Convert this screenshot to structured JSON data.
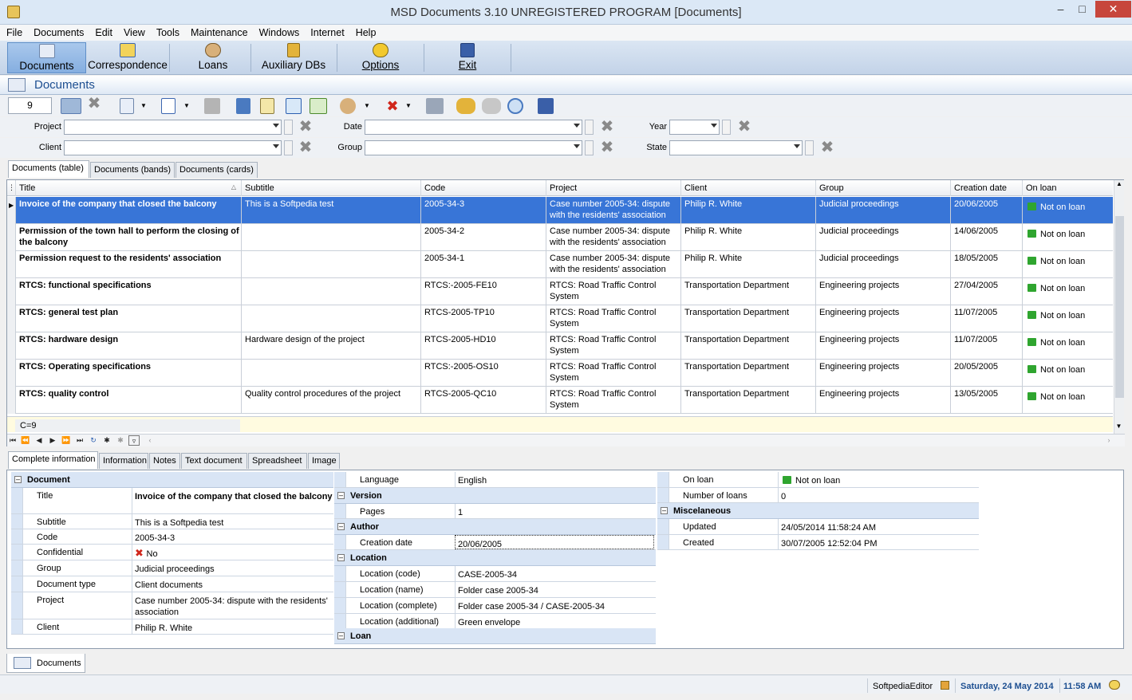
{
  "window": {
    "title": "MSD Documents 3.10 UNREGISTERED PROGRAM [Documents]"
  },
  "menu": [
    "File",
    "Documents",
    "Edit",
    "View",
    "Tools",
    "Maintenance",
    "Windows",
    "Internet",
    "Help"
  ],
  "maintoolbar": [
    {
      "label": "Documents",
      "icon": "documents-icon",
      "active": true
    },
    {
      "label": "Correspondence",
      "icon": "correspondence-arrows-icon"
    },
    {
      "label": "Loans",
      "icon": "loans-person-icon"
    },
    {
      "label": "Auxiliary DBs",
      "icon": "database-icon"
    },
    {
      "label": "Options",
      "icon": "options-gears-icon"
    },
    {
      "label": "Exit",
      "icon": "exit-door-icon"
    }
  ],
  "docheader": {
    "title": "Documents"
  },
  "smalltoolbar": {
    "count": "9"
  },
  "filters": {
    "project": "Project",
    "date": "Date",
    "year": "Year",
    "client": "Client",
    "group": "Group",
    "state": "State"
  },
  "gridtabs": [
    "Documents (table)",
    "Documents (bands)",
    "Documents (cards)"
  ],
  "grid": {
    "columns": [
      "Title",
      "Subtitle",
      "Code",
      "Project",
      "Client",
      "Group",
      "Creation date",
      "On loan"
    ],
    "rows": [
      {
        "title": "Invoice of the company that closed the balcony",
        "subtitle": "This is a Softpedia test",
        "code": "2005-34-3",
        "project": "Case number 2005-34: dispute with the residents' association",
        "client": "Philip R. White",
        "group": "Judicial proceedings",
        "date": "20/06/2005",
        "loan": "Not on loan"
      },
      {
        "title": "Permission of the town hall to perform the closing of the balcony",
        "subtitle": "",
        "code": "2005-34-2",
        "project": "Case number 2005-34: dispute with the residents' association",
        "client": "Philip R. White",
        "group": "Judicial proceedings",
        "date": "14/06/2005",
        "loan": "Not on loan"
      },
      {
        "title": "Permission request to the residents' association",
        "subtitle": "",
        "code": "2005-34-1",
        "project": "Case number 2005-34: dispute with the residents' association",
        "client": "Philip R. White",
        "group": "Judicial proceedings",
        "date": "18/05/2005",
        "loan": "Not on loan"
      },
      {
        "title": "RTCS: functional specifications",
        "subtitle": "",
        "code": "RTCS:-2005-FE10",
        "project": "RTCS: Road Traffic Control System",
        "client": "Transportation Department",
        "group": "Engineering projects",
        "date": "27/04/2005",
        "loan": "Not on loan"
      },
      {
        "title": "RTCS: general test plan",
        "subtitle": "",
        "code": "RTCS-2005-TP10",
        "project": "RTCS: Road Traffic Control System",
        "client": "Transportation Department",
        "group": "Engineering projects",
        "date": "11/07/2005",
        "loan": "Not on loan"
      },
      {
        "title": "RTCS: hardware design",
        "subtitle": "Hardware design of the project",
        "code": "RTCS-2005-HD10",
        "project": "RTCS: Road Traffic Control System",
        "client": "Transportation Department",
        "group": "Engineering projects",
        "date": "11/07/2005",
        "loan": "Not on loan"
      },
      {
        "title": "RTCS: Operating specifications",
        "subtitle": "",
        "code": "RTCS:-2005-OS10",
        "project": "RTCS: Road Traffic Control System",
        "client": "Transportation Department",
        "group": "Engineering projects",
        "date": "20/05/2005",
        "loan": "Not on loan"
      },
      {
        "title": "RTCS: quality control",
        "subtitle": "Quality control procedures of the project",
        "code": "RTCS-2005-QC10",
        "project": "RTCS: Road Traffic Control System",
        "client": "Transportation Department",
        "group": "Engineering projects",
        "date": "13/05/2005",
        "loan": "Not on loan"
      }
    ],
    "footer": "C=9"
  },
  "detailtabs": [
    "Complete information",
    "Information",
    "Notes",
    "Text document",
    "Spreadsheet",
    "Image"
  ],
  "details": {
    "col1": {
      "section": "Document",
      "rows": [
        {
          "k": "Title",
          "v": "Invoice of the company that closed the balcony",
          "bold": true
        },
        {
          "k": "Subtitle",
          "v": "This is a Softpedia test"
        },
        {
          "k": "Code",
          "v": "2005-34-3"
        },
        {
          "k": "Confidential",
          "v": "No"
        },
        {
          "k": "Group",
          "v": "Judicial proceedings"
        },
        {
          "k": "Document type",
          "v": "Client documents"
        },
        {
          "k": "Project",
          "v": "Case number 2005-34: dispute with the residents' association"
        },
        {
          "k": "Client",
          "v": "Philip R. White"
        }
      ]
    },
    "col2": {
      "language_k": "Language",
      "language_v": "English",
      "version": "Version",
      "pages_k": "Pages",
      "pages_v": "1",
      "author": "Author",
      "cdate_k": "Creation date",
      "cdate_v": "20/06/2005",
      "location": "Location",
      "loc_rows": [
        {
          "k": "Location (code)",
          "v": "CASE-2005-34"
        },
        {
          "k": "Location (name)",
          "v": "Folder case 2005-34"
        },
        {
          "k": "Location (complete)",
          "v": "Folder case 2005-34 / CASE-2005-34"
        },
        {
          "k": "Location (additional)",
          "v": "Green envelope"
        }
      ],
      "loan": "Loan"
    },
    "col3": {
      "onloan_k": "On loan",
      "onloan_v": "Not on loan",
      "nloans_k": "Number of loans",
      "nloans_v": "0",
      "misc": "Miscelaneous",
      "updated_k": "Updated",
      "updated_v": "24/05/2014 11:58:24 AM",
      "created_k": "Created",
      "created_v": "30/07/2005 12:52:04 PM"
    }
  },
  "bottomtab": "Documents",
  "status": {
    "user": "SoftpediaEditor",
    "date": "Saturday, 24 May 2014",
    "time": "11:58 AM"
  }
}
